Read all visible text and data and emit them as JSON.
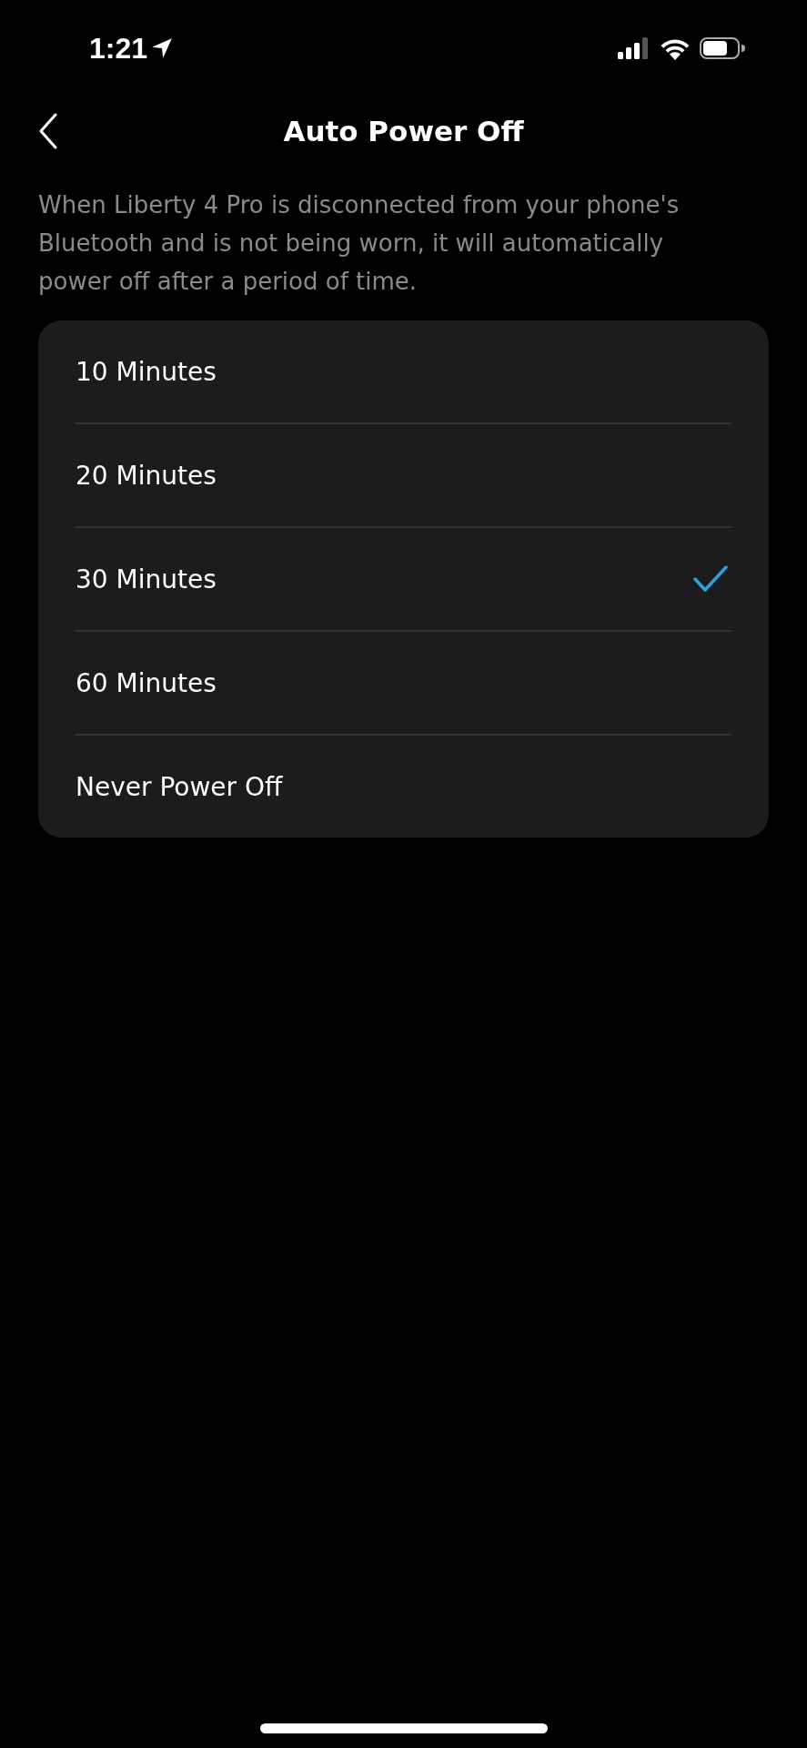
{
  "status_bar": {
    "time": "1:21"
  },
  "header": {
    "title": "Auto Power Off"
  },
  "description": "When Liberty 4 Pro is disconnected from your phone's Bluetooth and is not being worn, it will automatically power off after a period of time.",
  "options": [
    {
      "label": "10 Minutes",
      "selected": false
    },
    {
      "label": "20 Minutes",
      "selected": false
    },
    {
      "label": "30 Minutes",
      "selected": true
    },
    {
      "label": "60 Minutes",
      "selected": false
    },
    {
      "label": "Never Power Off",
      "selected": false
    }
  ]
}
